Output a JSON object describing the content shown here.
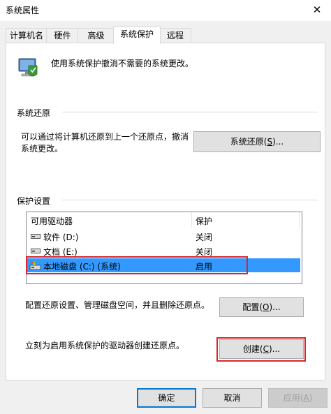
{
  "window": {
    "title": "系统属性",
    "close_glyph": "✕"
  },
  "tabs": [
    {
      "label": "计算机名",
      "active": false
    },
    {
      "label": "硬件",
      "active": false
    },
    {
      "label": "高级",
      "active": false
    },
    {
      "label": "系统保护",
      "active": true
    },
    {
      "label": "远程",
      "active": false
    }
  ],
  "intro": {
    "text": "使用系统保护撤消不需要的系统更改。",
    "icon": "system-protection-icon"
  },
  "restore": {
    "group_label": "系统还原",
    "description_line1": "可以通过将计算机还原到上一个还原点，撤消",
    "description_line2": "系统更改。",
    "button_label": "系统还原(",
    "button_key": "S",
    "button_suffix": ")..."
  },
  "protection": {
    "group_label": "保护设置",
    "columns": [
      "可用驱动器",
      "保护"
    ],
    "rows": [
      {
        "drive": "软件 (D:)",
        "status": "关闭",
        "selected": false,
        "icon": "hard-drive-icon"
      },
      {
        "drive": "文档 (E:)",
        "status": "关闭",
        "selected": false,
        "icon": "hard-drive-icon"
      },
      {
        "drive": "本地磁盘 (C:) (系统)",
        "status": "启用",
        "selected": true,
        "icon": "system-drive-icon"
      }
    ],
    "configure_text": "配置还原设置、管理磁盘空间，并且删除还原点。",
    "configure_label": "配置(",
    "configure_key": "O",
    "configure_suffix": ")...",
    "create_text": "立刻为启用系统保护的驱动器创建还原点。",
    "create_label": "创建(",
    "create_key": "C",
    "create_suffix": ")..."
  },
  "footer": {
    "ok_label": "确定",
    "cancel_label": "取消",
    "apply_label": "应用(",
    "apply_key": "A",
    "apply_suffix": ")"
  },
  "colors": {
    "selection": "#3399ff",
    "highlight_box": "#d9252b",
    "default_button_border": "#0078d7"
  }
}
